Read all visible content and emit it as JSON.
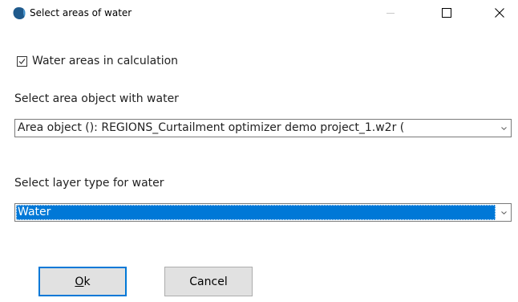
{
  "window": {
    "title": "Select areas of water",
    "icon": "app-logo-icon",
    "controls": {
      "minimize": "minimize-icon",
      "maximize": "maximize-icon",
      "close": "close-icon"
    }
  },
  "checkbox": {
    "label": "Water areas in calculation",
    "checked": true
  },
  "area_object": {
    "label": "Select area object with water",
    "value": "Area object (): REGIONS_Curtailment optimizer demo project_1.w2r ("
  },
  "layer_type": {
    "label": "Select layer type for water",
    "value": "Water"
  },
  "buttons": {
    "ok_mnemonic": "O",
    "ok_rest": "k",
    "cancel": "Cancel"
  },
  "colors": {
    "accent": "#0078d7",
    "button_face": "#e1e1e1"
  }
}
